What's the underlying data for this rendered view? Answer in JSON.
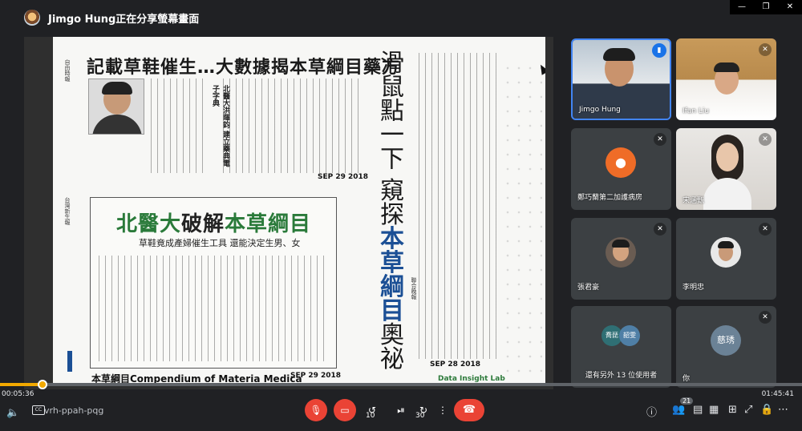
{
  "header": {
    "share_title": "Jimgo Hung正在分享螢幕畫面"
  },
  "window_controls": [
    "—",
    "❐",
    "✕"
  ],
  "shared_screen": {
    "clip1_title": "記載草鞋催生…大數據揭本草綱目藥方",
    "clip1_subhead": "北醫大洪暉鈞 建立藥典電子字典",
    "clip1_date": "SEP 29 2018",
    "clip2_title_a": "北醫大",
    "clip2_title_b": "破解",
    "clip2_title_c": "本草綱目",
    "clip2_subtitle": "草鞋竟成產婦催生工具 還能決定生男、女",
    "clip2_date": "SEP 29 2018",
    "clip3_vertical_a": "滑鼠點一下 窺探",
    "clip3_vertical_b": "本草綱目",
    "clip3_vertical_c": "奧祕",
    "clip3_date": "SEP 28 2018",
    "lab_label": "Data Insight Lab",
    "caption": "本草綱目Compendium of Materia Medica",
    "side_label_1": "自由時報",
    "side_label_2": "台灣新生報",
    "side_label_3": "聯合晚報"
  },
  "participants": [
    {
      "name": "Jimgo Hung",
      "speaking": true
    },
    {
      "name": "Ifan Liu",
      "speaking": false
    },
    {
      "name": "鄭巧蘭第二加護病房",
      "speaking": false
    },
    {
      "name": "宋涵甄",
      "speaking": false
    },
    {
      "name": "張君豪",
      "speaking": false
    },
    {
      "name": "李明忠",
      "speaking": false
    },
    {
      "name": "還有另外 13 位使用者",
      "speaking": false,
      "avatar_a": "喬琵",
      "avatar_b": "韶雯"
    },
    {
      "name": "你",
      "speaking": false,
      "avatar": "慈琇"
    }
  ],
  "playback": {
    "elapsed": "00:05:36",
    "duration": "01:45:41",
    "progress_fraction": 0.053
  },
  "controls": {
    "meeting_code": "vrh-ppah-pqg",
    "skip_back": "10",
    "skip_forward": "30",
    "participant_count": "21"
  },
  "colors": {
    "accent": "#f2a900",
    "danger": "#ea4335",
    "speaking": "#1a73e8"
  }
}
